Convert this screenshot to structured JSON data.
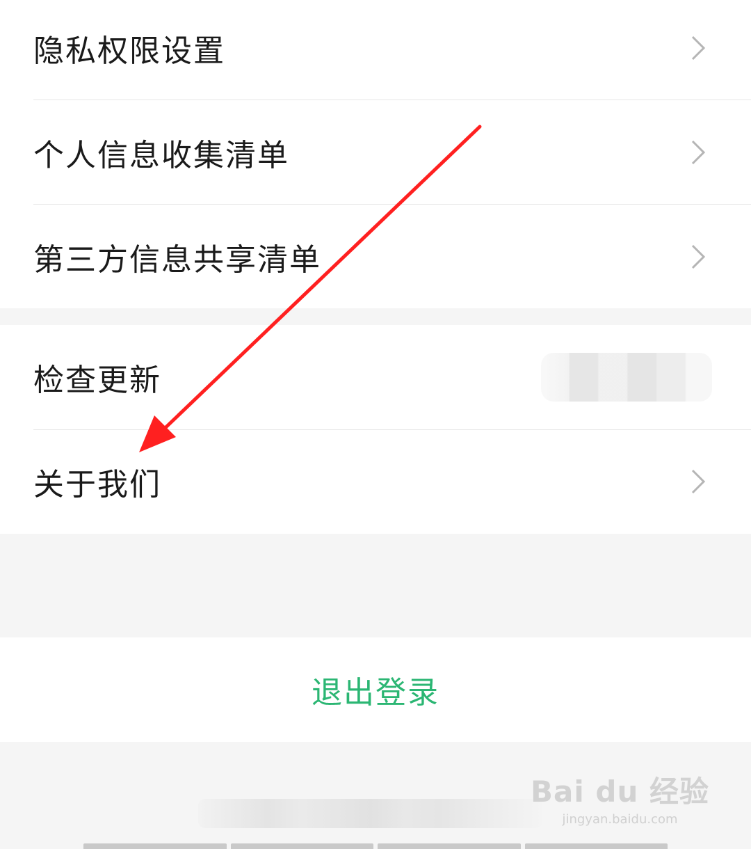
{
  "group1": {
    "items": [
      {
        "label": "隐私权限设置"
      },
      {
        "label": "个人信息收集清单"
      },
      {
        "label": "第三方信息共享清单"
      }
    ]
  },
  "group2": {
    "check_update": {
      "label": "检查更新",
      "value": ""
    },
    "about_us": {
      "label": "关于我们"
    }
  },
  "logout": {
    "label": "退出登录",
    "color": "#2bb673"
  },
  "annotation": {
    "arrow_color": "#ff2020"
  },
  "watermark": {
    "brand": "Bai du 经验",
    "url": "jingyan.baidu.com"
  },
  "icons": {
    "chevron": "chevron-right-icon"
  }
}
